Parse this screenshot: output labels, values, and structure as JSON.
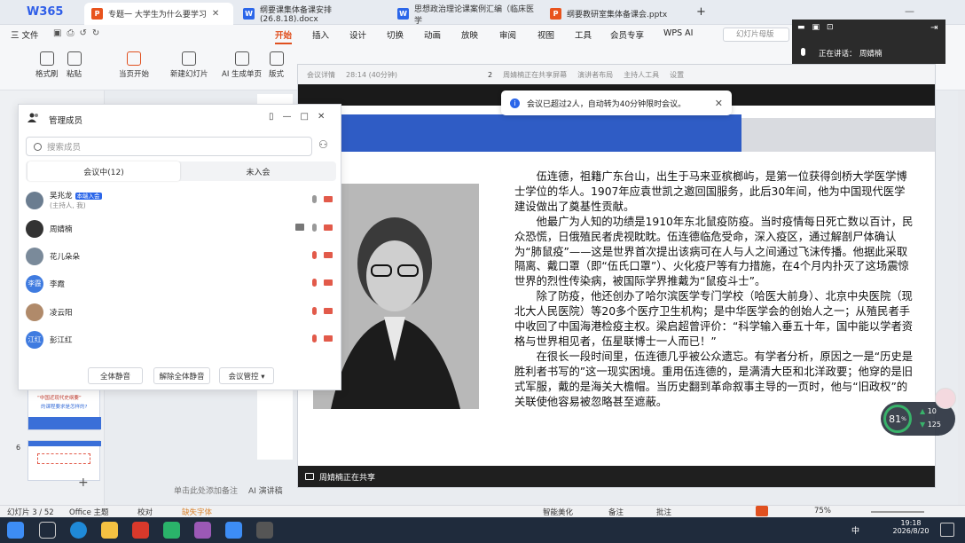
{
  "app": {
    "logo": "W365"
  },
  "tabs": [
    {
      "label": "专题一  大学生为什么要学习",
      "type": "p",
      "active": true
    },
    {
      "label": "纲要课集体备课安排(26.8.18).docx",
      "type": "w"
    },
    {
      "label": "思想政治理论课案例汇编（临床医学",
      "type": "w"
    },
    {
      "label": "纲要教研室集体备课会.pptx",
      "type": "p"
    }
  ],
  "menu": {
    "file": "三 文件",
    "items": [
      "开始",
      "插入",
      "设计",
      "切换",
      "动画",
      "放映",
      "审阅",
      "视图",
      "工具",
      "会员专享",
      "WPS AI"
    ],
    "selected": "开始",
    "search_placeholder": "幻灯片母版"
  },
  "ribbon": {
    "buttons": [
      "格式刷",
      "粘贴",
      "当页开始",
      "新建幻灯片",
      "AI 生成单页",
      "版式"
    ]
  },
  "meeting": {
    "toolbar": [
      "会议详情",
      "28:14 (40分钟)",
      "2",
      "周婧楠正在共享屏幕",
      "演讲者布局",
      "主持人工具",
      "设置"
    ],
    "share_status": "周婧楠正在共享",
    "notice": "会议已超过2人，自动转为40分钟限时会议。"
  },
  "slide": {
    "paragraphs": [
      "伍连德，祖籍广东台山，出生于马来亚槟榔屿，是第一位获得剑桥大学医学博士学位的华人。1907年应袁世凯之邀回国服务，此后30年间，他为中国现代医学建设做出了奠基性贡献。",
      "他最广为人知的功绩是1910年东北鼠疫防疫。当时疫情每日死亡数以百计，民众恐慌，日俄殖民者虎视眈眈。伍连德临危受命，深入疫区，通过解剖尸体确认为“肺鼠疫”——这是世界首次提出该病可在人与人之间通过飞沫传播。他据此采取隔离、戴口罩（即“伍氏口罩”）、火化疫尸等有力措施，在4个月内扑灭了这场震惊世界的烈性传染病，被国际学界推戴为“鼠疫斗士”。",
      "除了防疫，他还创办了哈尔滨医学专门学校（哈医大前身）、北京中央医院（现北大人民医院）等20多个医疗卫生机构；是中华医学会的创始人之一；从殖民者手中收回了中国海港检疫主权。梁启超曾评价：“科学输入垂五十年，国中能以学者资格与世界相见者，伍星联博士一人而已！”",
      "在很长一段时间里，伍连德几乎被公众遗忘。有学者分析，原因之一是“历史是胜利者书写的”这一现实困境。重用伍连德的，是满清大臣和北洋政要；他穿的是旧式军服，戴的是海关大檐帽。当历史翻到革命叙事主导的一页时，他与“旧政权”的关联使他容易被忽略甚至遮蔽。"
    ]
  },
  "members": {
    "title": "管理成员",
    "search_placeholder": "搜索成员",
    "tabs": [
      "会议中(12)",
      "未入会"
    ],
    "list": [
      {
        "name": "吴兆龙",
        "badge": "本端入会",
        "sub": "(主持人, 我)",
        "avatar": "",
        "color": "#6b7d90"
      },
      {
        "name": "周婧楠",
        "badge": "",
        "sub": "",
        "avatar": "",
        "color": "#333333"
      },
      {
        "name": "花儿朵朵",
        "badge": "",
        "sub": "",
        "avatar": "",
        "color": "#7a8a9a"
      },
      {
        "name": "李霞",
        "badge": "",
        "sub": "",
        "avatar": "李霞",
        "color": "#3f7be0"
      },
      {
        "name": "凌云阳",
        "badge": "",
        "sub": "",
        "avatar": "",
        "color": "#b08a6a"
      },
      {
        "name": "彭江红",
        "badge": "",
        "sub": "",
        "avatar": "江红",
        "color": "#3f7be0"
      }
    ],
    "buttons": [
      "全体静音",
      "解除全体静音",
      "会议管控 ▾"
    ]
  },
  "speaker": {
    "label": "正在讲话：",
    "name": "周婧楠"
  },
  "gauge": {
    "percent": "81",
    "unit": "%",
    "up": "10",
    "down": "125"
  },
  "thumbnails": {
    "slide6_num": "6",
    "thumb_text_a": "“中国近现代史纲要”",
    "thumb_text_b": "的课程要求是怎样的?"
  },
  "notes_placeholder": "单击此处添加备注",
  "ai_notes": "AI 演讲稿",
  "status": {
    "slide_count": "幻灯片 3 / 52",
    "theme": "Office 主题",
    "proof": "校对",
    "missing_font": "缺失字体",
    "smart_beautify": "智能美化",
    "notes": "备注",
    "comments": "批注",
    "zoom": "75%"
  },
  "taskbar": {
    "time": "19:18",
    "date": "2026/8/20",
    "ime": "中"
  }
}
